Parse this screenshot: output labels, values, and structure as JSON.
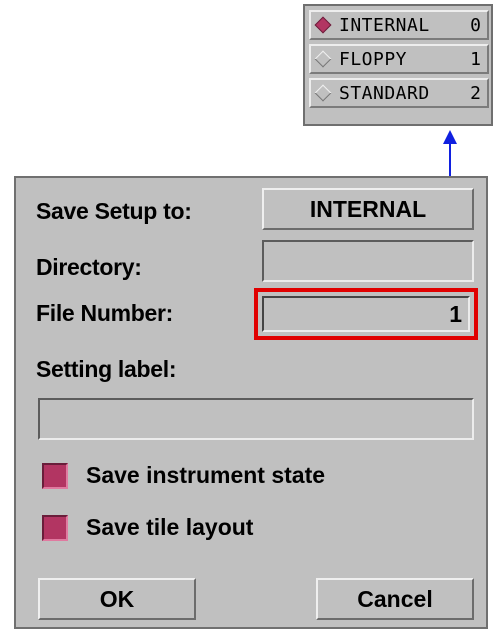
{
  "menu": {
    "items": [
      {
        "label": "INTERNAL",
        "number": "0",
        "selected": true
      },
      {
        "label": "FLOPPY",
        "number": "1",
        "selected": false
      },
      {
        "label": "STANDARD",
        "number": "2",
        "selected": false
      }
    ]
  },
  "dialog": {
    "save_setup_label": "Save Setup to:",
    "save_setup_value": "INTERNAL",
    "directory_label": "Directory:",
    "directory_value": "",
    "file_number_label": "File Number:",
    "file_number_value": "1",
    "setting_label_label": "Setting label:",
    "setting_label_value": "",
    "save_instrument_state": {
      "label": "Save instrument state",
      "checked": true
    },
    "save_tile_layout": {
      "label": "Save tile layout",
      "checked": true
    },
    "ok_label": "OK",
    "cancel_label": "Cancel"
  },
  "colors": {
    "accent": "#b23562",
    "highlight": "#e00000",
    "arrow": "#1020e0",
    "panel": "#c0c0c0"
  }
}
